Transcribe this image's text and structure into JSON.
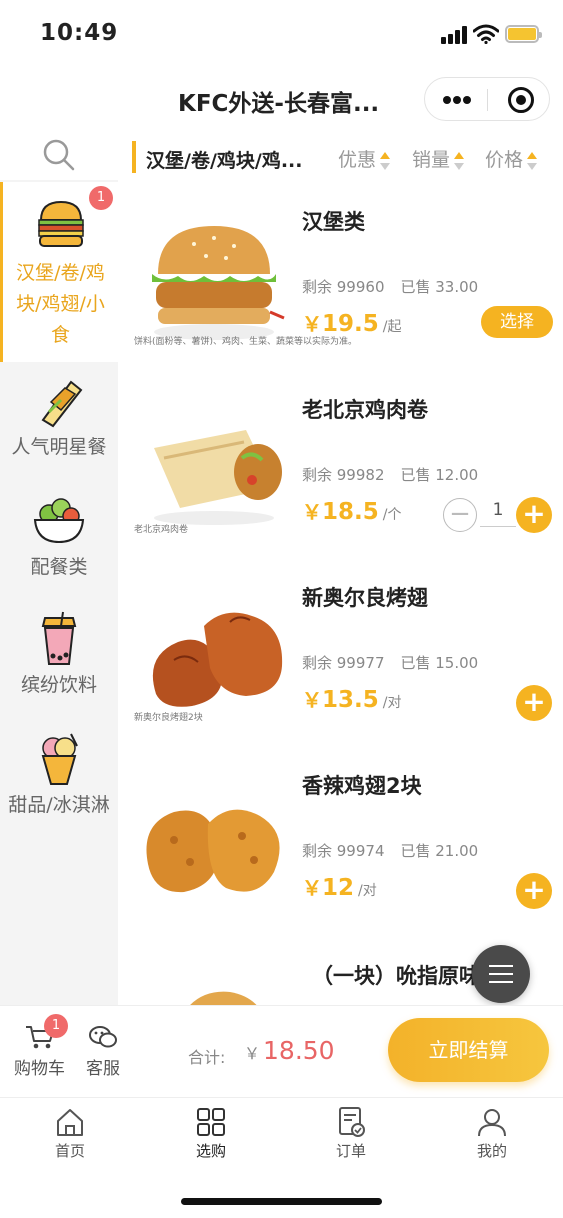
{
  "status": {
    "time": "10:49"
  },
  "nav": {
    "title": "KFC外送-长春富..."
  },
  "sidebar": {
    "categories": [
      {
        "label": "汉堡/卷/鸡块/鸡翅/小食",
        "badge": "1",
        "active": true
      },
      {
        "label": "人气明星餐"
      },
      {
        "label": "配餐类"
      },
      {
        "label": "缤纷饮料"
      },
      {
        "label": "甜品/冰淇淋"
      }
    ]
  },
  "filter": {
    "current_category": "汉堡/卷/鸡块/鸡...",
    "sorts": [
      "优惠",
      "销量",
      "价格"
    ]
  },
  "products": [
    {
      "name": "汉堡类",
      "stock_label": "剩余 99960",
      "sold_label": "已售 33.00",
      "currency": "￥",
      "price": "19.5",
      "unit": "/起",
      "image_caption": "饼料(面粉等、薯饼)、鸡肉、生菜、蔬菜等以实际为准。",
      "action_label": "选择"
    },
    {
      "name": "老北京鸡肉卷",
      "stock_label": "剩余 99982",
      "sold_label": "已售 12.00",
      "currency": "￥",
      "price": "18.5",
      "unit": "/个",
      "image_caption": "老北京鸡肉卷",
      "quantity": "1"
    },
    {
      "name": "新奥尔良烤翅",
      "stock_label": "剩余 99977",
      "sold_label": "已售 15.00",
      "currency": "￥",
      "price": "13.5",
      "unit": "/对",
      "image_caption": "新奥尔良烤翅2块"
    },
    {
      "name": "香辣鸡翅2块",
      "stock_label": "剩余 99974",
      "sold_label": "已售 21.00",
      "currency": "￥",
      "price": "12",
      "unit": "/对"
    },
    {
      "name": "（一块）吮指原味鸡"
    }
  ],
  "cart": {
    "cart_label": "购物车",
    "cart_badge": "1",
    "service_label": "客服",
    "total_label": "合计:",
    "currency": "￥",
    "total": "18.50",
    "checkout_label": "立即结算"
  },
  "tabs": [
    {
      "label": "首页",
      "icon": "home-icon"
    },
    {
      "label": "选购",
      "icon": "grid-icon",
      "active": true
    },
    {
      "label": "订单",
      "icon": "order-icon"
    },
    {
      "label": "我的",
      "icon": "profile-icon"
    }
  ],
  "colors": {
    "accent": "#f5b321",
    "price_total": "#e86565",
    "badge": "#f06a6a"
  }
}
